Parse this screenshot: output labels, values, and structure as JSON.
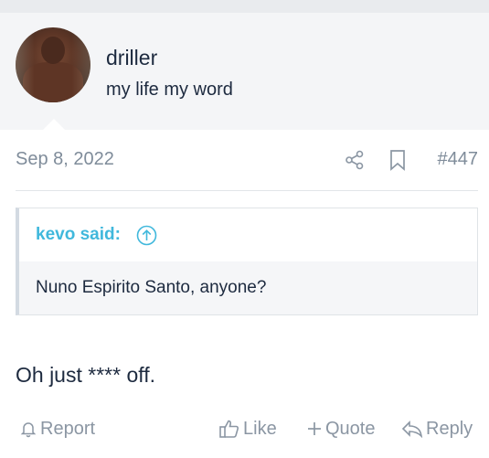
{
  "header": {
    "username": "driller",
    "user_title": "my life my word"
  },
  "post": {
    "date": "Sep 8, 2022",
    "number": "#447",
    "quote": {
      "author": "kevo said:",
      "text": "Nuno Espirito Santo, anyone?"
    },
    "text": "Oh just **** off."
  },
  "actions": {
    "report": "Report",
    "like": "Like",
    "quote": "Quote",
    "reply": "Reply"
  },
  "colors": {
    "accent": "#40b8dc",
    "muted": "#8b96a3",
    "text": "#1d2a3f",
    "header_bg": "#f4f5f7"
  },
  "icons": [
    "share-icon",
    "bookmark-icon",
    "arrow-up-circle-icon",
    "bell-icon",
    "thumbs-up-icon",
    "plus-icon",
    "reply-arrow-icon"
  ]
}
